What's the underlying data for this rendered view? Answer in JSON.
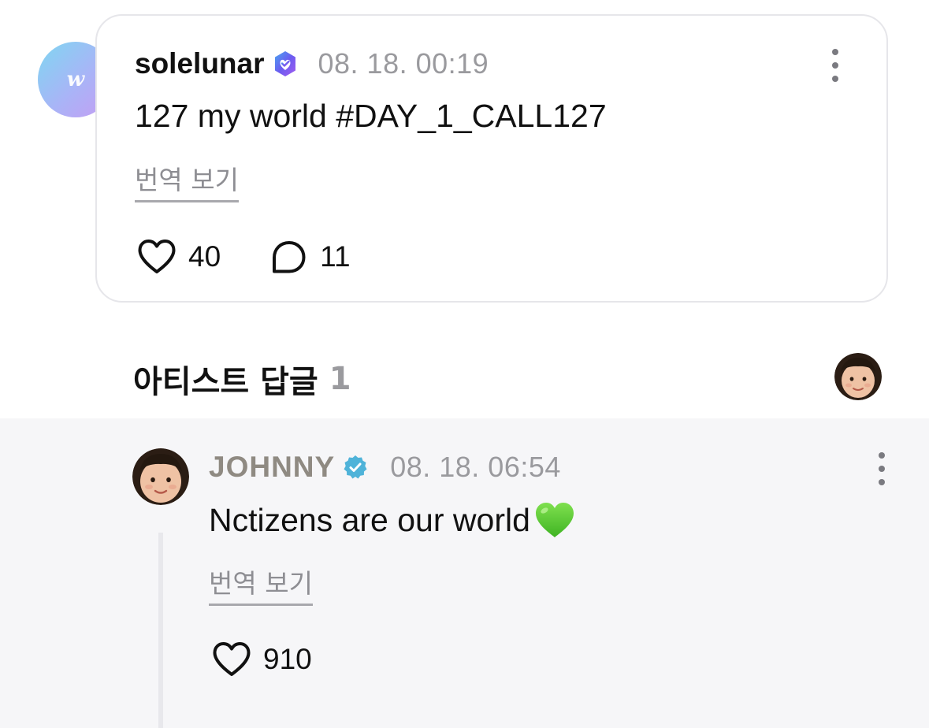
{
  "post": {
    "avatar_icon": "weverse-w-icon",
    "username": "solelunar",
    "verified_icon": "weverse-verified-badge-icon",
    "timestamp": "08. 18. 00:19",
    "text": "127 my world #DAY_1_CALL127",
    "translate_label": "번역 보기",
    "like_count": "40",
    "comment_count": "11",
    "more_icon": "more-vertical-icon"
  },
  "artist_replies": {
    "title": "아티스트 답글",
    "count": "1"
  },
  "reply": {
    "username": "JOHNNY",
    "verified_icon": "verified-check-icon",
    "timestamp": "08. 18. 06:54",
    "text": "Nctizens are our world",
    "emoji": "green-heart-emoji",
    "translate_label": "번역 보기",
    "like_count": "910",
    "more_icon": "more-vertical-icon"
  },
  "colors": {
    "verified_post_badge": "#6b5cf0",
    "verified_artist_badge": "#4fb3d9",
    "artist_name": "#8f8a82",
    "timestamp": "#9a9a9e",
    "reply_background": "#f6f6f8",
    "card_border": "#e6e6ea",
    "green_heart": "#5ed334"
  }
}
